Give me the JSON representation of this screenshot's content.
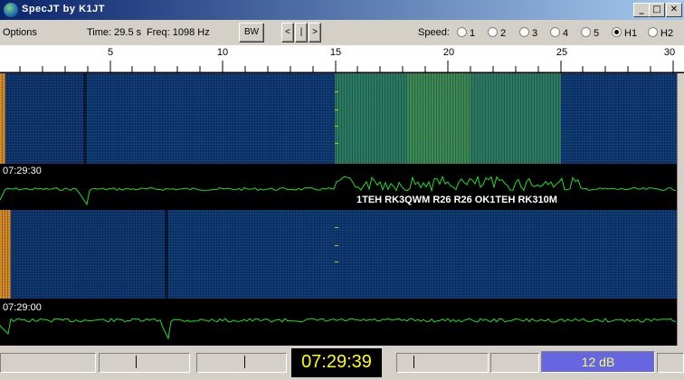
{
  "window": {
    "title": "SpecJT    by K1JT",
    "minimize": "_",
    "maximize": "□",
    "close": "✕"
  },
  "toolbar": {
    "options": "Options",
    "time": "Time: 29.5 s",
    "freq": "Freq: 1098 Hz",
    "bw_label": "BW",
    "nav_prev": "<",
    "nav_mid": "|",
    "nav_next": ">",
    "speed_label": "Speed:",
    "speeds": [
      "1",
      "2",
      "3",
      "4",
      "5",
      "H1",
      "H2"
    ],
    "speed_selected": "H1"
  },
  "ruler": {
    "labels": [
      "5",
      "10",
      "15",
      "20",
      "25",
      "30"
    ]
  },
  "display": {
    "panel1_time": "07:29:30",
    "panel2_time": "07:29:00",
    "decoded_text": "1TEH RK3QWM R26 R26 OK1TEH RK310M"
  },
  "status": {
    "clock": "07:29:39",
    "level": "12 dB"
  },
  "colors": {
    "trace": "#22dd22",
    "clock_text": "#ffff00",
    "level_bg": "#6666e0"
  }
}
